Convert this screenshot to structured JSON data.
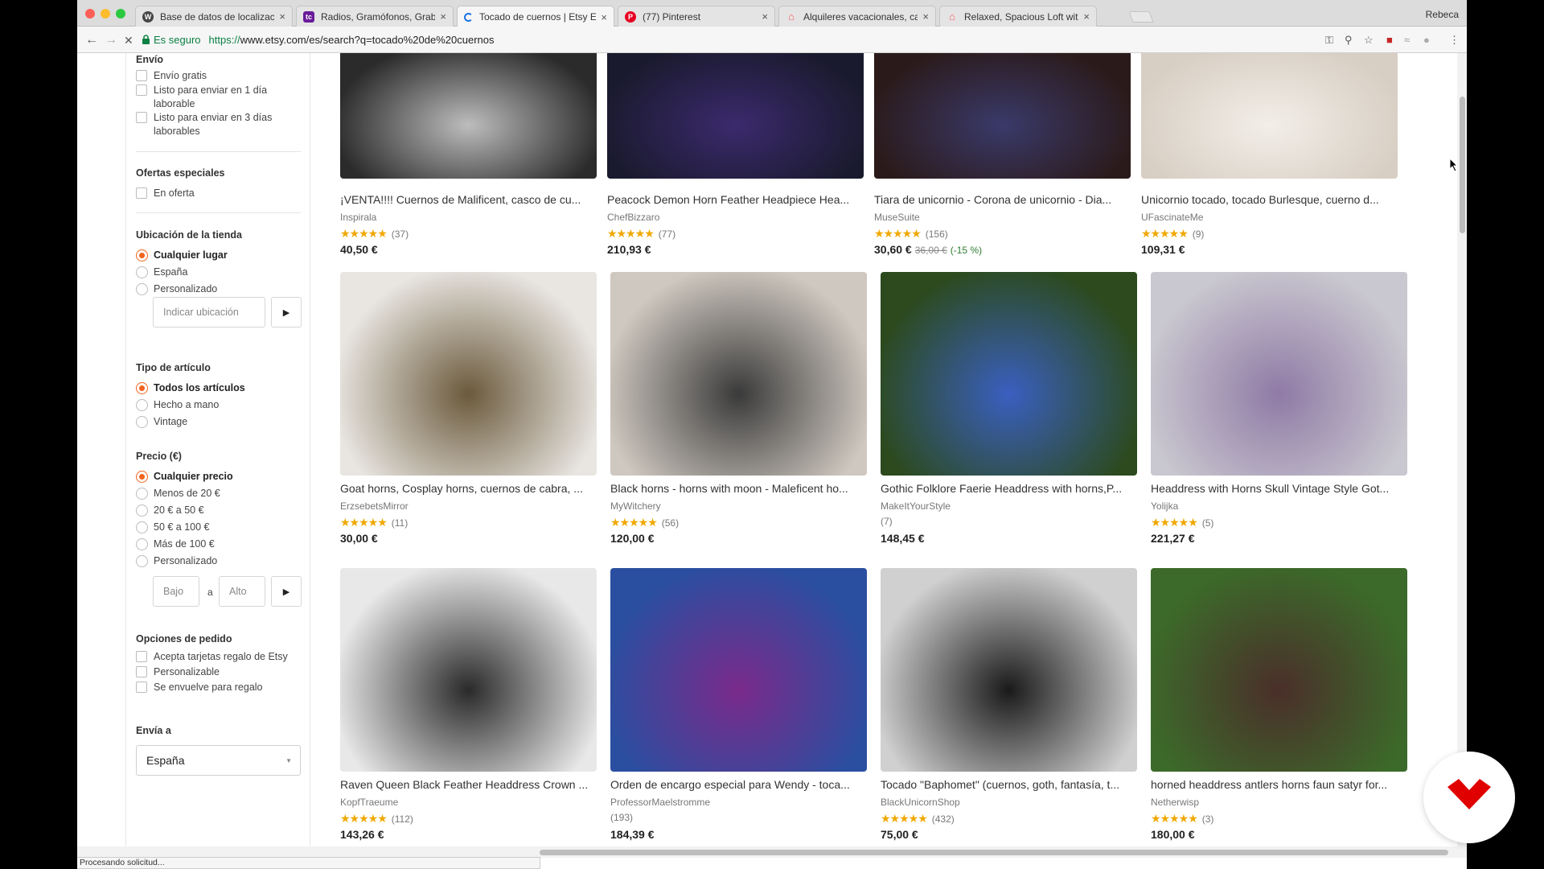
{
  "browser": {
    "profile_name": "Rebeca",
    "tabs": [
      {
        "label": "Base de datos de localizacione",
        "favicon": "wordpress-icon",
        "color": "#464646"
      },
      {
        "label": "Radios, Gramófonos, Grabado",
        "favicon": "tc-icon",
        "color": "#6a1b9a"
      },
      {
        "label": "Tocado de cuernos | Etsy ES",
        "favicon": "loading-icon",
        "color": "#1a73e8"
      },
      {
        "label": "(77) Pinterest",
        "favicon": "pinterest-icon",
        "color": "#e60023"
      },
      {
        "label": "Alquileres vacacionales, casas",
        "favicon": "airbnb-icon",
        "color": "#ff5a5f"
      },
      {
        "label": "Relaxed, Spacious Loft with Je",
        "favicon": "airbnb-icon",
        "color": "#ff5a5f"
      }
    ],
    "secure_label": "Es seguro",
    "url_scheme": "https://",
    "url_rest": "www.etsy.com/es/search?q=tocado%20de%20cuernos",
    "status_text": "Procesando solicitud..."
  },
  "filters": {
    "shipping": {
      "heading": "Envío",
      "options": [
        "Envío gratis",
        "Listo para enviar en 1 día laborable",
        "Listo para enviar en 3 días laborables"
      ]
    },
    "special": {
      "heading": "Ofertas especiales",
      "options": [
        "En oferta"
      ]
    },
    "location": {
      "heading": "Ubicación de la tienda",
      "options": [
        "Cualquier lugar",
        "España",
        "Personalizado"
      ],
      "placeholder": "Indicar ubicación"
    },
    "item_type": {
      "heading": "Tipo de artículo",
      "options": [
        "Todos los artículos",
        "Hecho a mano",
        "Vintage"
      ]
    },
    "price": {
      "heading": "Precio (€)",
      "options": [
        "Cualquier precio",
        "Menos de 20 €",
        "20 € a 50 €",
        "50 € a 100 €",
        "Más de 100 €",
        "Personalizado"
      ],
      "low_placeholder": "Bajo",
      "to_label": "a",
      "high_placeholder": "Alto"
    },
    "order": {
      "heading": "Opciones de pedido",
      "options": [
        "Acepta tarjetas regalo de Etsy",
        "Personalizable",
        "Se envuelve para regalo"
      ]
    },
    "ship_to": {
      "heading": "Envía a",
      "value": "España"
    }
  },
  "listings": [
    {
      "title": "¡VENTA!!!! Cuernos de Malificent, casco de cu...",
      "shop": "Inspirala",
      "stars": "★★★★★",
      "reviews": "(37)",
      "price": "40,50 €"
    },
    {
      "title": "Peacock Demon Horn Feather Headpiece Hea...",
      "shop": "ChefBizzaro",
      "stars": "★★★★★",
      "reviews": "(77)",
      "price": "210,93 €"
    },
    {
      "title": "Tiara de unicornio - Corona de unicornio - Dia...",
      "shop": "MuseSuite",
      "stars": "★★★★★",
      "reviews": "(156)",
      "price": "30,60 €",
      "old_price": "36,00 €",
      "discount": "(-15 %)"
    },
    {
      "title": "Unicornio tocado, tocado Burlesque, cuerno d...",
      "shop": "UFascinateMe",
      "stars": "★★★★★",
      "reviews": "(9)",
      "price": "109,31 €"
    },
    {
      "title": "Goat horns, Cosplay horns, cuernos de cabra, ...",
      "shop": "ErzsebetsMirror",
      "stars": "★★★★★",
      "reviews": "(11)",
      "price": "30,00 €"
    },
    {
      "title": "Black horns - horns with moon - Maleficent ho...",
      "shop": "MyWitchery",
      "stars": "★★★★★",
      "reviews": "(56)",
      "price": "120,00 €"
    },
    {
      "title": "Gothic Folklore Faerie Headdress with horns,P...",
      "shop": "MakeItYourStyle",
      "stars": "",
      "reviews": "(7)",
      "price": "148,45 €"
    },
    {
      "title": "Headdress with Horns Skull Vintage Style Got...",
      "shop": "Yolijka",
      "stars": "★★★★★",
      "reviews": "(5)",
      "price": "221,27 €"
    },
    {
      "title": "Raven Queen Black Feather Headdress Crown ...",
      "shop": "KopfTraeume",
      "stars": "★★★★★",
      "reviews": "(112)",
      "price": "143,26 €"
    },
    {
      "title": "Orden de encargo especial para Wendy - toca...",
      "shop": "ProfessorMaelstromme",
      "stars": "",
      "reviews": "(193)",
      "price": "184,39 €"
    },
    {
      "title": "Tocado \"Baphomet\" (cuernos, goth, fantasía, t...",
      "shop": "BlackUnicornShop",
      "stars": "★★★★★",
      "reviews": "(432)",
      "price": "75,00 €"
    },
    {
      "title": "horned headdress antlers horns faun satyr for...",
      "shop": "Netherwisp",
      "stars": "★★★★★",
      "reviews": "(3)",
      "price": "180,00 €"
    }
  ],
  "colors": {
    "accent": "#f1641e",
    "stars": "#f0a800",
    "badge": "#e00000"
  }
}
